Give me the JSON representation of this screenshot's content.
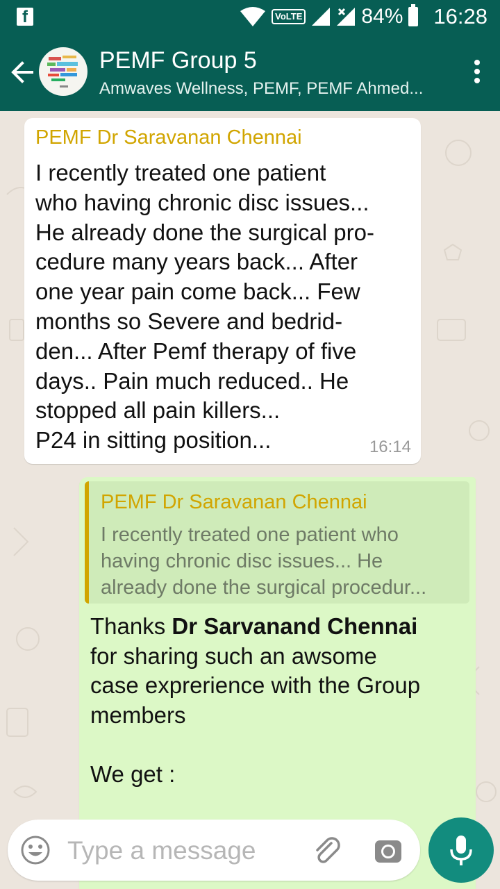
{
  "status_bar": {
    "network_badge": "VoLTE",
    "battery_percent": "84%",
    "time": "16:28"
  },
  "header": {
    "title": "PEMF Group 5",
    "subtitle": "Amwaves Wellness, PEMF, PEMF Ahmed..."
  },
  "messages": [
    {
      "direction": "incoming",
      "sender": "PEMF Dr Saravanan Chennai",
      "lines": [
        "I recently treated one patient",
        "who having chronic disc issues...",
        "He already done the surgical pro-",
        "cedure many years back... After",
        "one year pain come back... Few",
        "months so Severe and bedrid-",
        "den... After Pemf therapy of five",
        "days.. Pain much reduced.. He",
        "stopped all pain killers...",
        "P24 in sitting position..."
      ],
      "time": "16:14"
    },
    {
      "direction": "outgoing",
      "quote": {
        "sender": "PEMF Dr Saravanan Chennai",
        "lines": [
          "I recently treated one patient who",
          "having chronic disc issues... He",
          "already done the surgical procedur..."
        ]
      },
      "reply": {
        "prefix": "Thanks ",
        "bold": "Dr Sarvanand Chennai",
        "line2": "for sharing such an awsome",
        "line3": "case exprerience with the Group",
        "line4": "members",
        "line6": "We get :"
      }
    }
  ],
  "input": {
    "placeholder": "Type a message"
  },
  "colors": {
    "header": "#075e54",
    "sender_name": "#d1a500",
    "outgoing_bubble": "#dcf8c6",
    "mic_button": "#128c7e"
  }
}
